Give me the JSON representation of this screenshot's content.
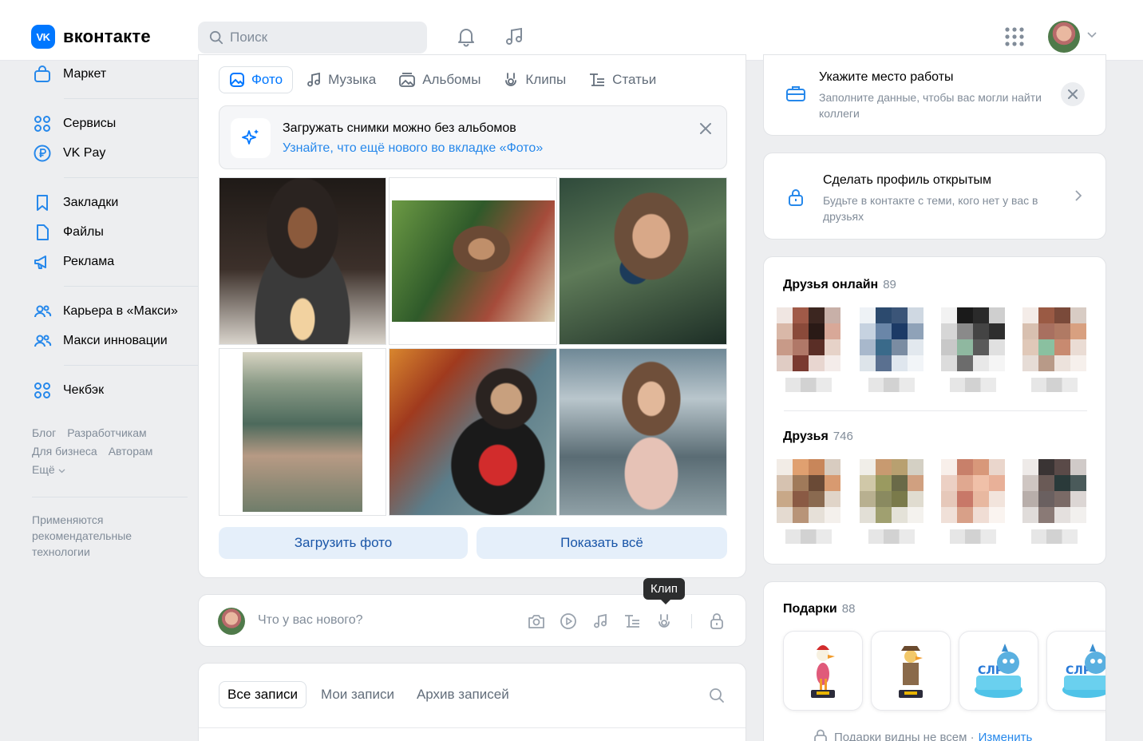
{
  "header": {
    "logo_mark": "VK",
    "logo_text": "вконтакте",
    "search_placeholder": "Поиск"
  },
  "sidebar": {
    "items": [
      {
        "label": "Маркет",
        "icon": "bag-icon"
      },
      {
        "label": "Сервисы",
        "icon": "grid-services-icon"
      },
      {
        "label": "VK Pay",
        "icon": "ruble-coin-icon"
      },
      {
        "label": "Закладки",
        "icon": "bookmark-icon"
      },
      {
        "label": "Файлы",
        "icon": "document-icon"
      },
      {
        "label": "Реклама",
        "icon": "megaphone-icon"
      },
      {
        "label": "Карьера в «Макси»",
        "icon": "group-icon"
      },
      {
        "label": "Макси инновации",
        "icon": "group-icon"
      },
      {
        "label": "Чекбэк",
        "icon": "grid-services-icon"
      }
    ],
    "footer_links": [
      "Блог",
      "Разработчикам",
      "Для бизнеса",
      "Авторам",
      "Ещё"
    ],
    "rec_note": "Применяются рекомендательные технологии"
  },
  "photo_section": {
    "tabs": [
      {
        "label": "Фото",
        "icon": "photo-icon",
        "active": true
      },
      {
        "label": "Музыка",
        "icon": "music-icon",
        "active": false
      },
      {
        "label": "Альбомы",
        "icon": "albums-icon",
        "active": false
      },
      {
        "label": "Клипы",
        "icon": "clips-icon",
        "active": false
      },
      {
        "label": "Статьи",
        "icon": "articles-icon",
        "active": false
      }
    ],
    "banner_title": "Загружать снимки можно без альбомов",
    "banner_sub": "Узнайте, что ещё нового во вкладке «Фото»",
    "upload_label": "Загрузить фото",
    "show_all_label": "Показать всё"
  },
  "composer": {
    "placeholder": "Что у вас нового?",
    "tooltip": "Клип"
  },
  "feed": {
    "tabs": [
      "Все записи",
      "Мои записи",
      "Архив записей"
    ]
  },
  "right": {
    "work": {
      "title": "Укажите место работы",
      "sub": "Заполните данные, чтобы вас могли найти коллеги"
    },
    "open_profile": {
      "title": "Сделать профиль открытым",
      "sub": "Будьте в контакте с теми, кого нет у вас в друзьях"
    },
    "friends_online": {
      "title": "Друзья онлайн",
      "count": "89"
    },
    "friends": {
      "title": "Друзья",
      "count": "746"
    },
    "gifts": {
      "title": "Подарки",
      "count": "88",
      "note": "Подарки видны не всем ·",
      "link": "Изменить"
    }
  },
  "colors": {
    "accent": "#0077ff",
    "link": "#2688eb",
    "background": "#edeef0"
  }
}
